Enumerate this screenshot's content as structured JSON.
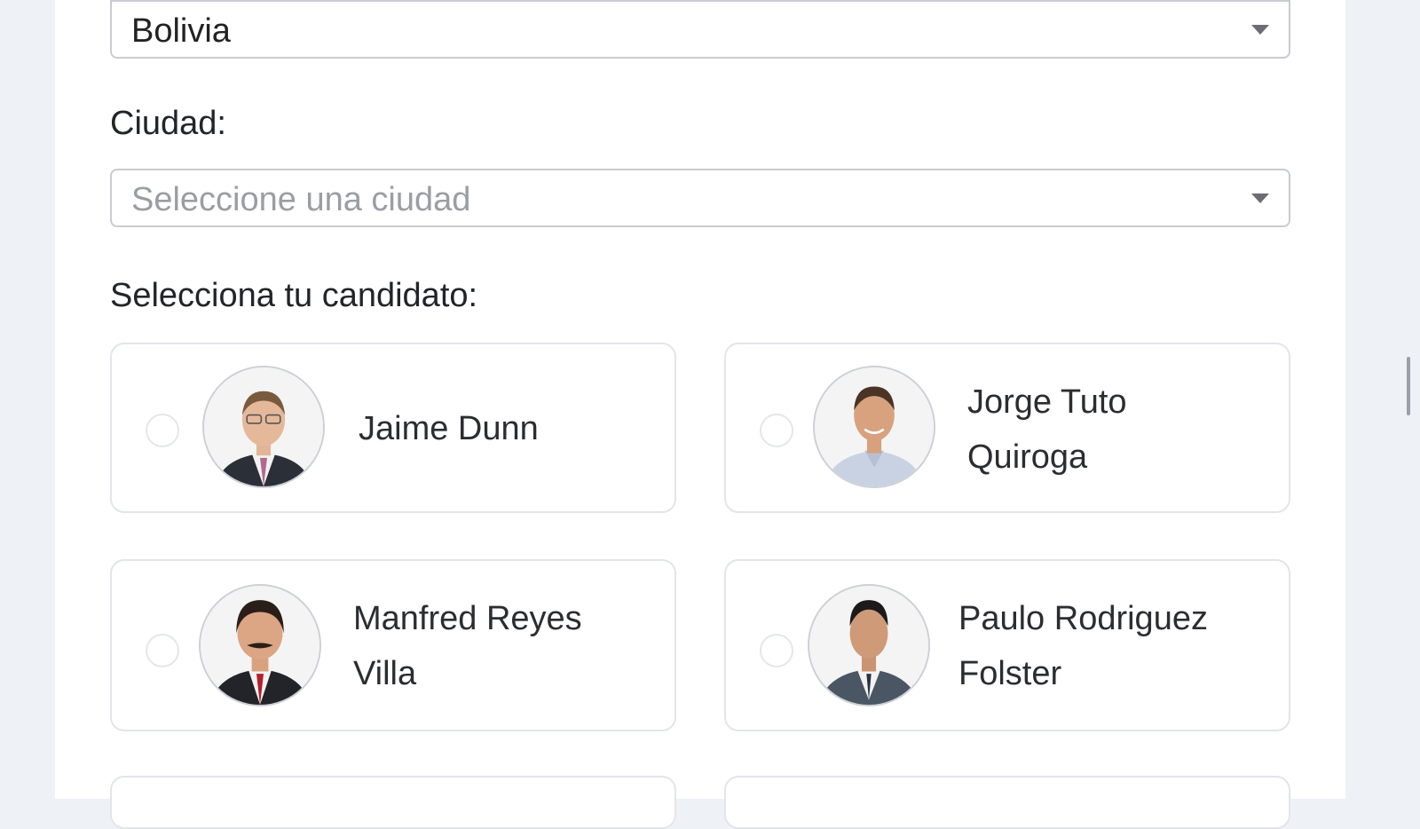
{
  "country_select": {
    "value": "Bolivia"
  },
  "city": {
    "label": "Ciudad:",
    "placeholder": "Seleccione una ciudad"
  },
  "candidates_section": {
    "label": "Selecciona tu candidato:",
    "candidates": [
      {
        "name": "Jaime Dunn"
      },
      {
        "name": "Jorge Tuto Quiroga"
      },
      {
        "name": "Manfred Reyes Villa"
      },
      {
        "name": "Paulo Rodriguez Folster"
      }
    ]
  },
  "colors": {
    "accent_border": "#c8ccd2",
    "placeholder": "#9a9ea4",
    "page_background": "#eef1f6"
  },
  "icons": [
    "chevron-down-icon",
    "radio-icon",
    "avatar-photo"
  ]
}
